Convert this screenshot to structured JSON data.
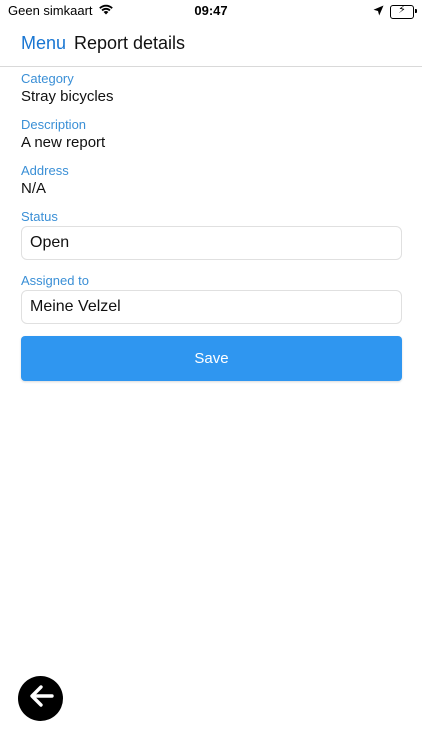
{
  "status_bar": {
    "carrier": "Geen simkaart",
    "time": "09:47",
    "wifi_icon": "wifi-icon",
    "location_icon": "location-arrow-icon",
    "battery_icon": "battery-charging-icon",
    "battery_color": "#34c759"
  },
  "header": {
    "menu_label": "Menu",
    "title": "Report details",
    "accent_color": "#1976d2"
  },
  "report": {
    "category_label": "Category",
    "category_value": "Stray bicycles",
    "description_label": "Description",
    "description_value": "A new report",
    "address_label": "Address",
    "address_value": "N/A",
    "status_label": "Status",
    "status_value": "Open",
    "assigned_label": "Assigned to",
    "assigned_value": "Meine Velzel"
  },
  "actions": {
    "save_label": "Save",
    "save_color": "#2f96f0",
    "back_icon": "arrow-left-icon"
  }
}
